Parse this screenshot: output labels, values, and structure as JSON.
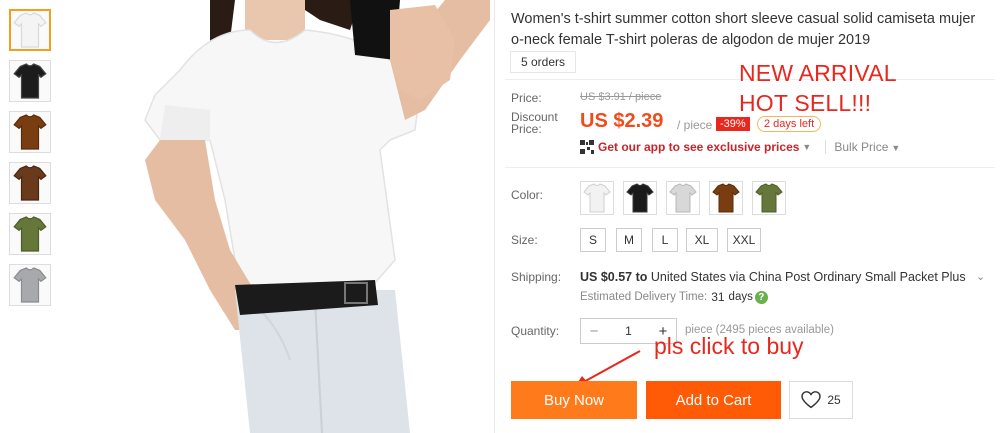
{
  "product": {
    "title": "Women's t-shirt summer cotton short sleeve casual solid camiseta mujer o-neck female T-shirt poleras de algodon de mujer 2019",
    "orders": "5 orders"
  },
  "thumbnails": [
    {
      "color": "#f4f4f4",
      "trim": "#d9d9d9"
    },
    {
      "color": "#1c1c1c",
      "trim": "#444"
    },
    {
      "color": "#7a3d12",
      "trim": "#5a2b0b"
    },
    {
      "color": "#6a3a1c",
      "trim": "#4a2612"
    },
    {
      "color": "#66773a",
      "trim": "#4f5d2b"
    },
    {
      "color": "#a7a9ad",
      "trim": "#8a8c90"
    }
  ],
  "promo": {
    "line1": "NEW ARRIVAL",
    "line2": "HOT SELL!!!",
    "cta_note": "pls click to buy"
  },
  "price": {
    "label": "Price:",
    "original": "US $3.91 / piece",
    "discount_label_1": "Discount",
    "discount_label_2": "Price:",
    "current": "US $2.39",
    "per": "/ piece",
    "discount_badge": "-39%",
    "time_left": "2 days left",
    "app_link": "Get our app to see exclusive prices",
    "bulk": "Bulk Price"
  },
  "color": {
    "label": "Color:",
    "options": [
      {
        "shirt": "#f2f2f2",
        "trim": "#cfcfcf"
      },
      {
        "shirt": "#1a1a1a",
        "trim": "#3a3a3a"
      },
      {
        "shirt": "#d8d8d8",
        "trim": "#b8b8b8"
      },
      {
        "shirt": "#7a3d12",
        "trim": "#5a2b0b"
      },
      {
        "shirt": "#66773a",
        "trim": "#4f5d2b"
      }
    ]
  },
  "size": {
    "label": "Size:",
    "options": [
      "S",
      "M",
      "L",
      "XL",
      "XXL"
    ]
  },
  "shipping": {
    "label": "Shipping:",
    "cost": "US $0.57",
    "to": "to",
    "destination": "United States via China Post Ordinary Small Packet Plus",
    "delivery_label": "Estimated Delivery Time:",
    "delivery_value": "31",
    "delivery_unit": "days"
  },
  "quantity": {
    "label": "Quantity:",
    "value": "1",
    "available": "piece (2495 pieces available)"
  },
  "actions": {
    "buy_now": "Buy Now",
    "add_to_cart": "Add to Cart",
    "wishlist_count": "25"
  }
}
